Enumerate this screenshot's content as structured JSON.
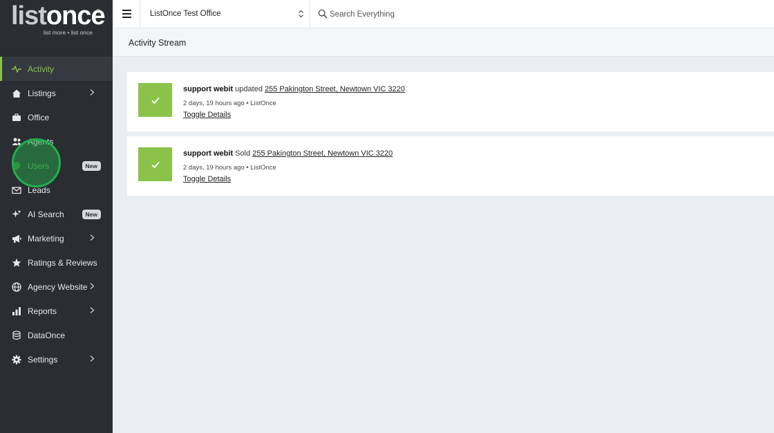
{
  "logo": {
    "word_a": "list",
    "word_b": "once",
    "reg": "®",
    "tagline": "list more • list once"
  },
  "nav": {
    "items": [
      {
        "label": "Activity"
      },
      {
        "label": "Listings"
      },
      {
        "label": "Office"
      },
      {
        "label": "Agents"
      },
      {
        "label": "Users",
        "badge": "New"
      },
      {
        "label": "Leads"
      },
      {
        "label": "AI Search",
        "badge": "New"
      },
      {
        "label": "Marketing"
      },
      {
        "label": "Ratings & Reviews"
      },
      {
        "label": "Agency Website"
      },
      {
        "label": "Reports"
      },
      {
        "label": "DataOnce"
      },
      {
        "label": "Settings"
      }
    ]
  },
  "topbar": {
    "office": "ListOnce Test Office",
    "search_placeholder": "Search Everything"
  },
  "page": {
    "title": "Activity Stream"
  },
  "activities": [
    {
      "user": "support webit",
      "action": "updated",
      "address": "255 Pakington Street, Newtown VIC 3220",
      "meta": "2 days, 19 hours ago • ListOnce",
      "toggle": "Toggle Details"
    },
    {
      "user": "support webit",
      "action": "Sold",
      "address": "255 Pakington Street, Newtown VIC 3220",
      "meta": "2 days, 19 hours ago • ListOnce",
      "toggle": "Toggle Details"
    }
  ],
  "colors": {
    "accent": "#8bc34a",
    "sidebar": "#2a2d31"
  }
}
